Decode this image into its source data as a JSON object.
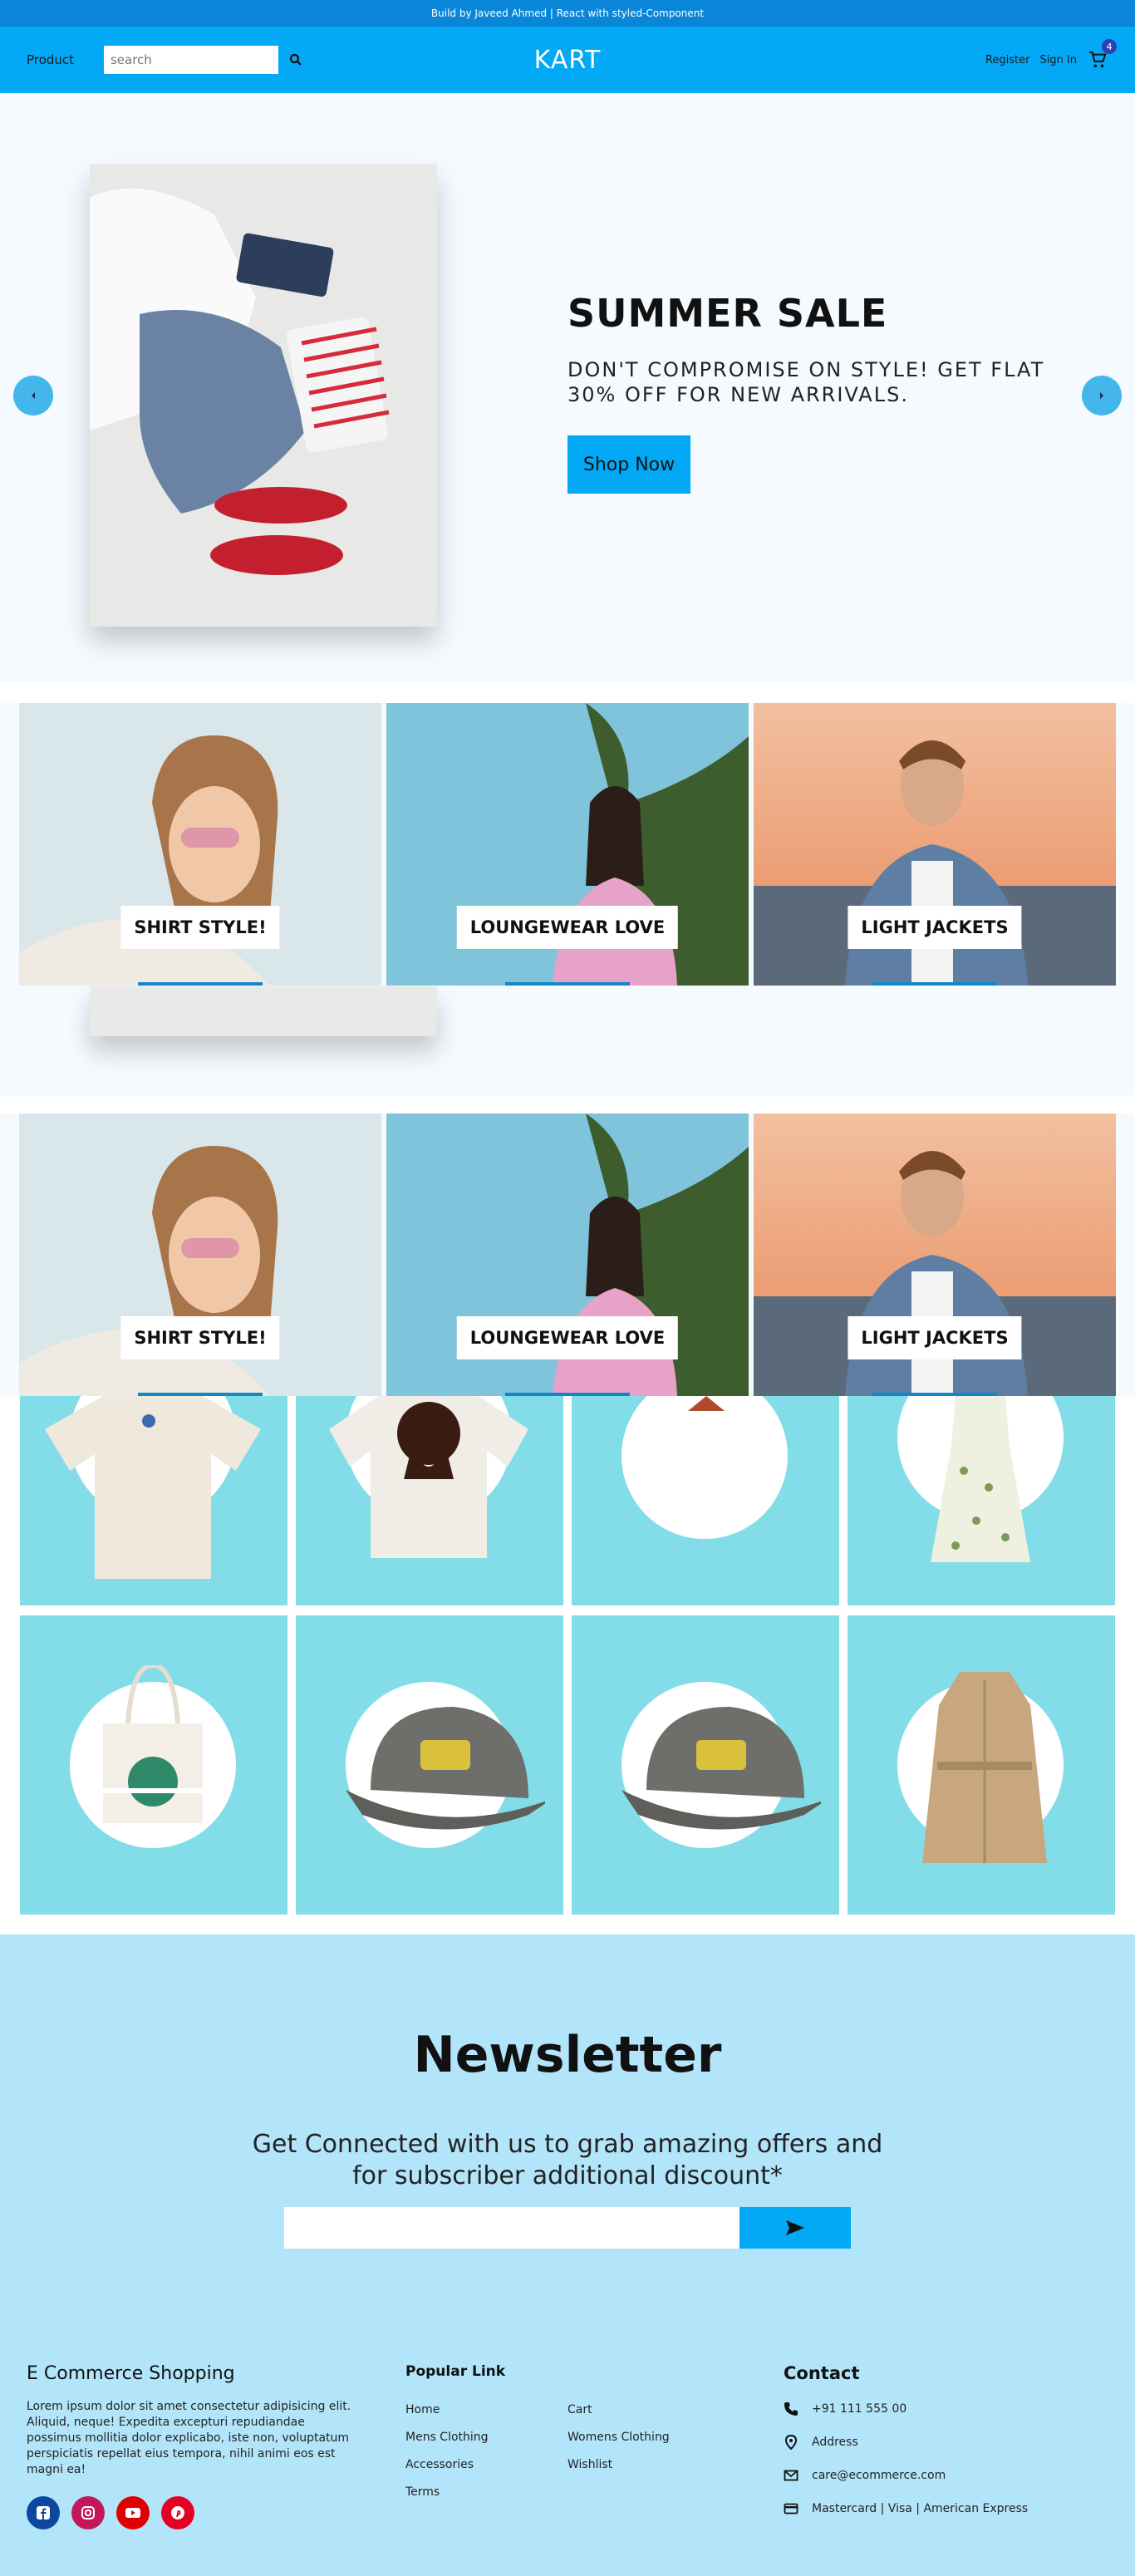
{
  "announcement": "Build by Javeed Ahmed | React with styled-Component",
  "navbar": {
    "product_link": "Product",
    "search_placeholder": "search",
    "logo": "KART",
    "register": "Register",
    "sign_in": "Sign In",
    "cart_count": "4"
  },
  "hero": {
    "title": "SUMMER SALE",
    "description": "DON'T COMPROMISE ON STYLE! GET FLAT 30% OFF FOR NEW ARRIVALS.",
    "button": "Shop Now"
  },
  "categories": [
    {
      "label": "SHIRT STYLE!"
    },
    {
      "label": "LOUNGEWEAR LOVE"
    },
    {
      "label": "LIGHT JACKETS"
    }
  ],
  "categories_repeat": [
    {
      "label": "SHIRT STYLE!"
    },
    {
      "label": "LOUNGEWEAR LOVE"
    },
    {
      "label": "LIGHT JACKETS"
    }
  ],
  "newsletter": {
    "title": "Newsletter",
    "description": "Get Connected with us to grab amazing offers and for subscriber additional discount*"
  },
  "footer": {
    "brand_title": "E Commerce Shopping",
    "brand_desc": "Lorem ipsum dolor sit amet consectetur adipisicing elit. Aliquid, neque! Expedita excepturi repudiandae possimus mollitia dolor explicabo, iste non, voluptatum perspiciatis repellat eius tempora, nihil animi eos est magni ea!",
    "popular_title": "Popular Link",
    "links_col1": [
      "Home",
      "Mens Clothing",
      "Accessories",
      "Terms"
    ],
    "links_col2": [
      "Cart",
      "Womens Clothing",
      "Wishlist"
    ],
    "contact_title": "Contact",
    "phone": "+91 111 555 00",
    "address": "Address",
    "email": "care@ecommerce.com",
    "payment": "Mastercard | Visa | American Express"
  },
  "colors": {
    "primary": "#03a9f4",
    "announcement": "#0a86d9",
    "newsletter_bg": "#b3e5fa",
    "tile_bg": "#82dde9",
    "facebook": "#0d47a1",
    "instagram": "#c2185b",
    "youtube": "#e00000",
    "pinterest": "#e60023"
  }
}
